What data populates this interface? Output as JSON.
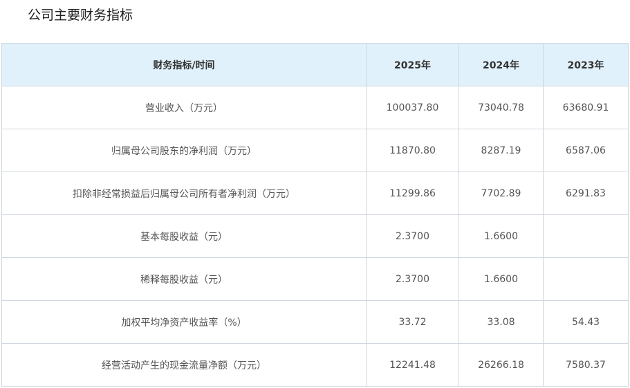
{
  "title": "公司主要财务指标",
  "table": {
    "headers": [
      "财务指标/时间",
      "2025年",
      "2024年",
      "2023年"
    ],
    "rows": [
      {
        "label": "营业收入（万元）",
        "v2025": "100037.80",
        "v2024": "73040.78",
        "v2023": "63680.91"
      },
      {
        "label": "归属母公司股东的净利润（万元）",
        "v2025": "11870.80",
        "v2024": "8287.19",
        "v2023": "6587.06"
      },
      {
        "label": "扣除非经常损益后归属母公司所有者净利润（万元）",
        "v2025": "11299.86",
        "v2024": "7702.89",
        "v2023": "6291.83"
      },
      {
        "label": "基本每股收益（元）",
        "v2025": "2.3700",
        "v2024": "1.6600",
        "v2023": ""
      },
      {
        "label": "稀释每股收益（元）",
        "v2025": "2.3700",
        "v2024": "1.6600",
        "v2023": ""
      },
      {
        "label": "加权平均净资产收益率（%）",
        "v2025": "33.72",
        "v2024": "33.08",
        "v2023": "54.43"
      },
      {
        "label": "经营活动产生的现金流量净额（万元）",
        "v2025": "12241.48",
        "v2024": "26266.18",
        "v2023": "7580.37"
      }
    ]
  }
}
